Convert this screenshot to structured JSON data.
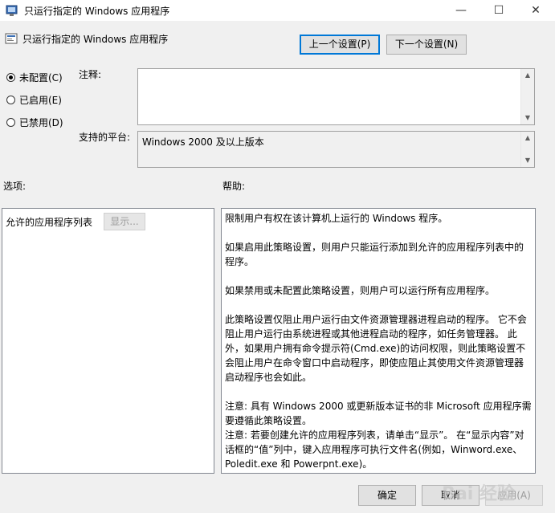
{
  "window": {
    "title": "只运行指定的 Windows 应用程序",
    "minimize": "—",
    "maximize": "☐",
    "close": "✕"
  },
  "policy": {
    "title": "只运行指定的 Windows 应用程序",
    "prev_button": "上一个设置(P)",
    "next_button": "下一个设置(N)"
  },
  "state": {
    "options": [
      {
        "label": "未配置(C)",
        "checked": true
      },
      {
        "label": "已启用(E)",
        "checked": false
      },
      {
        "label": "已禁用(D)",
        "checked": false
      }
    ]
  },
  "comment": {
    "label": "注释:",
    "value": ""
  },
  "platform": {
    "label": "支持的平台:",
    "value": "Windows 2000 及以上版本"
  },
  "options_section": {
    "label": "选项:",
    "list_label": "允许的应用程序列表",
    "show_button": "显示..."
  },
  "help_section": {
    "label": "帮助:",
    "paragraphs": [
      "限制用户有权在该计算机上运行的 Windows 程序。",
      "如果启用此策略设置，则用户只能运行添加到允许的应用程序列表中的程序。",
      "如果禁用或未配置此策略设置，则用户可以运行所有应用程序。",
      "此策略设置仅阻止用户运行由文件资源管理器进程启动的程序。 它不会阻止用户运行由系统进程或其他进程启动的程序，如任务管理器。 此外，如果用户拥有命令提示符(Cmd.exe)的访问权限，则此策略设置不会阻止用户在命令窗口中启动程序，即使应阻止其使用文件资源管理器启动程序也会如此。",
      "注意: 具有 Windows 2000 或更新版本证书的非 Microsoft 应用程序需要遵循此策略设置。",
      "注意: 若要创建允许的应用程序列表，请单击“显示”。 在“显示内容”对话框的“值”列中，键入应用程序可执行文件名(例如，Winword.exe、Poledit.exe 和 Powerpnt.exe)。"
    ]
  },
  "footer": {
    "ok": "确定",
    "cancel": "取消",
    "apply": "应用(A)"
  },
  "watermark": "Bai 经验"
}
